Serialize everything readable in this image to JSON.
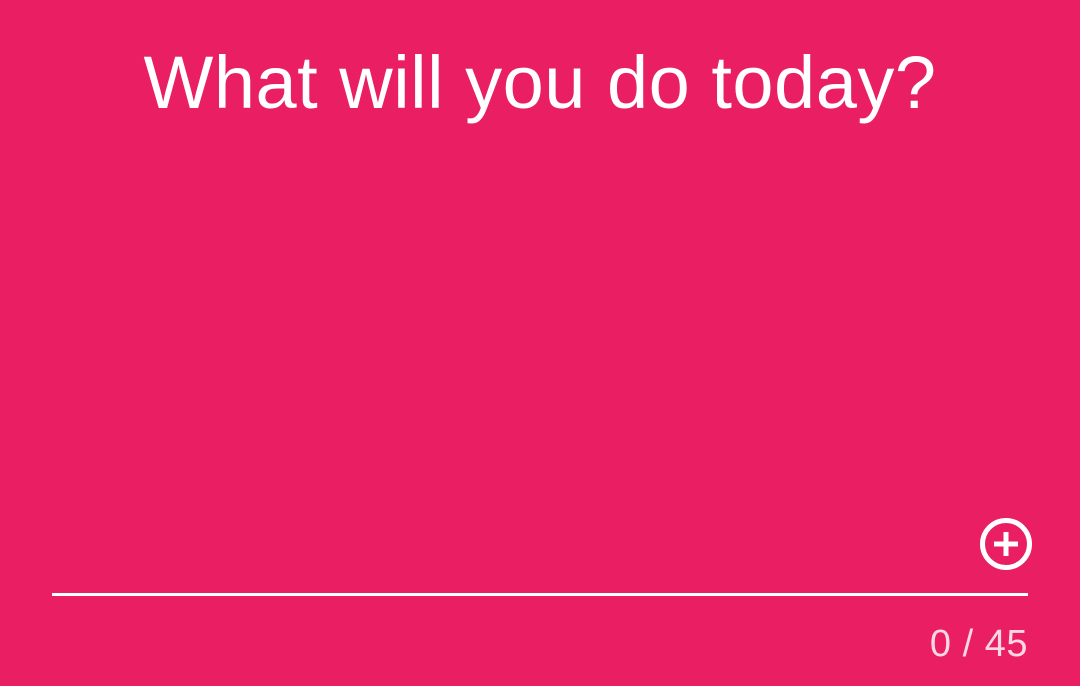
{
  "screen": {
    "background_color": "#E91E63",
    "text_color": "#FFFFFF"
  },
  "header": {
    "title": "What will you do today?"
  },
  "task_input": {
    "value": ""
  },
  "add_button": {
    "icon": "add-circle-outline-icon"
  },
  "counter": {
    "current": 0,
    "max": 45,
    "text": "0 / 45"
  }
}
